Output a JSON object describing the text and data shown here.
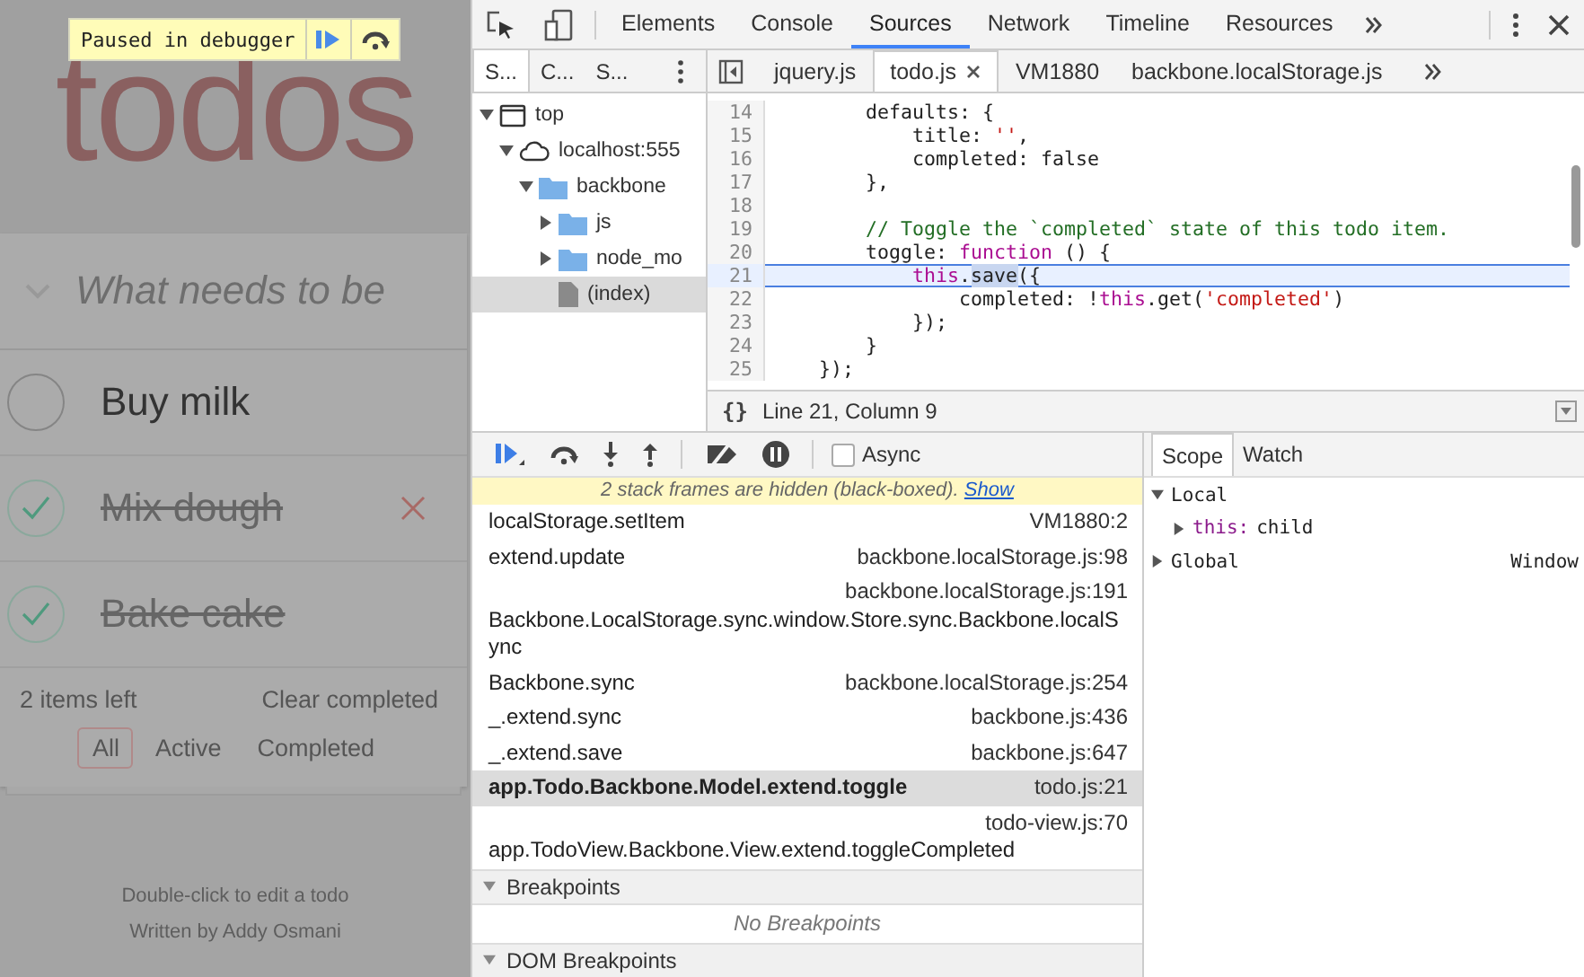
{
  "app": {
    "title": "todos",
    "placeholder": "What needs to be",
    "todos": [
      {
        "title": "Buy milk",
        "completed": false,
        "show_delete": false
      },
      {
        "title": "Mix dough",
        "completed": true,
        "show_delete": true
      },
      {
        "title": "Bake cake",
        "completed": true,
        "show_delete": false
      }
    ],
    "items_left": "2 items left",
    "clear_completed": "Clear completed",
    "filters": [
      {
        "label": "All",
        "selected": true
      },
      {
        "label": "Active",
        "selected": false
      },
      {
        "label": "Completed",
        "selected": false
      }
    ],
    "info": [
      "Double-click to edit a todo",
      "Written by Addy Osmani"
    ]
  },
  "paused_overlay": {
    "label": "Paused in debugger"
  },
  "devtools": {
    "panel_tabs": [
      {
        "label": "Elements",
        "selected": false
      },
      {
        "label": "Console",
        "selected": false
      },
      {
        "label": "Sources",
        "selected": true
      },
      {
        "label": "Network",
        "selected": false
      },
      {
        "label": "Timeline",
        "selected": false
      },
      {
        "label": "Resources",
        "selected": false
      }
    ],
    "navigator_tabs": [
      {
        "label": "S...",
        "selected": true
      },
      {
        "label": "C...",
        "selected": false
      },
      {
        "label": "S...",
        "selected": false
      }
    ],
    "editor_tabs": [
      {
        "label": "jquery.js",
        "selected": false
      },
      {
        "label": "todo.js",
        "selected": true
      },
      {
        "label": "VM1880",
        "selected": false
      },
      {
        "label": "backbone.localStorage.js",
        "selected": false
      }
    ],
    "tree": [
      {
        "label": "top",
        "kind": "frame",
        "expanded": true,
        "selected": false,
        "children": [
          {
            "label": "localhost:555",
            "kind": "domain",
            "expanded": true,
            "selected": false,
            "children": [
              {
                "label": "backbone",
                "kind": "folder",
                "expanded": true,
                "selected": false,
                "children": [
                  {
                    "label": "js",
                    "kind": "folder",
                    "expanded": false,
                    "selected": false
                  },
                  {
                    "label": "node_mo",
                    "kind": "folder",
                    "expanded": false,
                    "selected": false
                  },
                  {
                    "label": "(index)",
                    "kind": "file",
                    "selected": true
                  }
                ]
              }
            ]
          }
        ]
      }
    ],
    "code": [
      {
        "number": "14",
        "current": false,
        "tokens": [
          {
            "text": "        defaults: {",
            "kind": "plain"
          }
        ]
      },
      {
        "number": "15",
        "current": false,
        "tokens": [
          {
            "text": "            title: ",
            "kind": "plain"
          },
          {
            "text": "''",
            "kind": "string"
          },
          {
            "text": ",",
            "kind": "plain"
          }
        ]
      },
      {
        "number": "16",
        "current": false,
        "tokens": [
          {
            "text": "            completed: false",
            "kind": "plain"
          }
        ]
      },
      {
        "number": "17",
        "current": false,
        "tokens": [
          {
            "text": "        },",
            "kind": "plain"
          }
        ]
      },
      {
        "number": "18",
        "current": false
      },
      {
        "number": "19",
        "current": false,
        "tokens": [
          {
            "text": "        // Toggle the `completed` state of this todo item.",
            "kind": "comment"
          }
        ]
      },
      {
        "number": "20",
        "current": false,
        "tokens": [
          {
            "text": "        toggle: ",
            "kind": "plain"
          },
          {
            "text": "function",
            "kind": "keyword"
          },
          {
            "text": " () {",
            "kind": "plain"
          }
        ]
      },
      {
        "number": "21",
        "current": true,
        "tokens": [
          {
            "text": "            this",
            "kind": "keyword"
          },
          {
            "text": ".",
            "kind": "plain"
          },
          {
            "text": "save",
            "kind": "selection"
          },
          {
            "text": "({",
            "kind": "plain"
          }
        ]
      },
      {
        "number": "22",
        "current": false,
        "tokens": [
          {
            "text": "                completed: !",
            "kind": "plain"
          },
          {
            "text": "this",
            "kind": "keyword"
          },
          {
            "text": ".get(",
            "kind": "plain"
          },
          {
            "text": "'completed'",
            "kind": "string"
          },
          {
            "text": ")",
            "kind": "plain"
          }
        ]
      },
      {
        "number": "23",
        "current": false,
        "tokens": [
          {
            "text": "            });",
            "kind": "plain"
          }
        ]
      },
      {
        "number": "24",
        "current": false,
        "tokens": [
          {
            "text": "        }",
            "kind": "plain"
          }
        ]
      },
      {
        "number": "25",
        "current": false,
        "tokens": [
          {
            "text": "    });",
            "kind": "plain"
          }
        ]
      }
    ],
    "pretty_print": "{}",
    "cursor_position": "Line 21, Column 9",
    "async": {
      "label": "Async",
      "checked": false
    },
    "blackbox_notice": {
      "text": "2 stack frames are hidden (black-boxed).",
      "link": "Show"
    },
    "call_stack": [
      {
        "kind": "inline",
        "function": "localStorage.setItem",
        "location": "VM1880:2",
        "selected": false
      },
      {
        "kind": "inline",
        "function": "extend.update",
        "location": "backbone.localStorage.js:98",
        "selected": false
      },
      {
        "kind": "stacked",
        "function": "Backbone.LocalStorage.sync.window.Store.sync.Backbone.localSync",
        "location": "backbone.localStorage.js:191",
        "selected": false
      },
      {
        "kind": "inline",
        "function": "Backbone.sync",
        "location": "backbone.localStorage.js:254",
        "selected": false
      },
      {
        "kind": "inline",
        "function": "_.extend.sync",
        "location": "backbone.js:436",
        "selected": false
      },
      {
        "kind": "inline",
        "function": "_.extend.save",
        "location": "backbone.js:647",
        "selected": false
      },
      {
        "kind": "inline",
        "function": "app.Todo.Backbone.Model.extend.toggle",
        "location": "todo.js:21",
        "selected": true
      },
      {
        "kind": "stacked",
        "function": "app.TodoView.Backbone.View.extend.toggleCompleted",
        "location": "todo-view.js:70",
        "selected": false
      }
    ],
    "sections": [
      {
        "title": "Breakpoints",
        "expanded": true,
        "empty_text": "No Breakpoints"
      },
      {
        "title": "DOM Breakpoints",
        "expanded": true
      }
    ],
    "sidebar_tabs": [
      {
        "label": "Scope",
        "selected": true
      },
      {
        "label": "Watch",
        "selected": false
      }
    ],
    "scope": [
      {
        "name": "Local",
        "expanded": true,
        "children": [
          {
            "name": "this:",
            "value": "child",
            "expanded": false
          }
        ]
      },
      {
        "name": "Global",
        "value": "Window",
        "expanded": false
      }
    ]
  }
}
